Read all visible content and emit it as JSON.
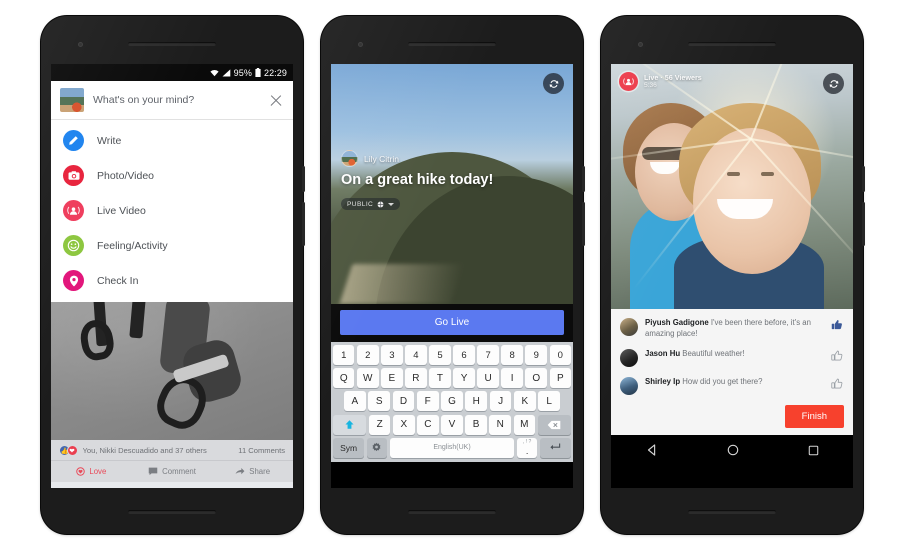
{
  "scene": {
    "title": "Facebook Live — three Android phone mockups",
    "background_color": "#ffffff"
  },
  "phone1": {
    "status_bar": {
      "wifi_icon": "wifi-icon",
      "signal_icon": "cell-signal-icon",
      "battery_percent": "95%",
      "battery_icon": "battery-icon",
      "clock": "22:29"
    },
    "composer": {
      "avatar": "user-avatar",
      "placeholder": "What's on your mind?",
      "close_icon": "close-icon"
    },
    "menu_items": [
      {
        "label": "Write",
        "icon": "pencil-icon",
        "color": "#1b82ef",
        "glyph": "✎"
      },
      {
        "label": "Photo/Video",
        "icon": "camera-icon",
        "color": "#e7203a",
        "glyph": "◉"
      },
      {
        "label": "Live Video",
        "icon": "live-video-icon",
        "color": "#ef3b5b",
        "glyph": "◉"
      },
      {
        "label": "Feeling/Activity",
        "icon": "smiley-icon",
        "color": "#8cc63e",
        "glyph": "☺"
      },
      {
        "label": "Check In",
        "icon": "location-pin-icon",
        "color": "#e2147a",
        "glyph": "◉"
      }
    ],
    "post": {
      "photo_alt": "gym-rings-photo",
      "reaction_like_icon": "like-icon",
      "reaction_love_icon": "love-icon",
      "reactions_text": "You, Nikki Descuadido and 37 others",
      "comments_count": "11 Comments",
      "actions": [
        {
          "label": "Love",
          "icon": "love-icon"
        },
        {
          "label": "Comment",
          "icon": "comment-icon"
        },
        {
          "label": "Share",
          "icon": "share-icon"
        }
      ]
    }
  },
  "phone2": {
    "flip_camera_icon": "flip-camera-icon",
    "user_name": "Lily Citrin",
    "caption": "On a great hike today!",
    "privacy": {
      "label": "PUBLIC",
      "icon": "globe-icon",
      "caret": "chevron-down-icon"
    },
    "go_live_label": "Go Live",
    "go_live_color": "#5b79f0",
    "keyboard": {
      "row_numbers": [
        "1",
        "2",
        "3",
        "4",
        "5",
        "6",
        "7",
        "8",
        "9",
        "0"
      ],
      "row_top": [
        "Q",
        "W",
        "E",
        "R",
        "T",
        "Y",
        "U",
        "I",
        "O",
        "P"
      ],
      "row_home": [
        "A",
        "S",
        "D",
        "F",
        "G",
        "H",
        "J",
        "K",
        "L"
      ],
      "row_bottom": [
        "Z",
        "X",
        "C",
        "V",
        "B",
        "N",
        "M"
      ],
      "shift_icon": "shift-arrow-icon",
      "backspace_icon": "backspace-icon",
      "sym_label": "Sym",
      "settings_icon": "gear-icon",
      "space_label": "English(UK)",
      "period_key": ".",
      "period_sub": ", ! ?",
      "enter_icon": "enter-icon"
    }
  },
  "phone3": {
    "live_badge_icon": "live-broadcast-icon",
    "live_status": "Live · 56 Viewers",
    "live_timer": "5:36",
    "flip_camera_icon": "flip-camera-icon",
    "video_alt": "two-women-selfie-live-video",
    "comments": [
      {
        "name": "Piyush Gadigone",
        "text": "I've been there before, it's an amazing place!",
        "liked": true,
        "thumb_icon": "thumbs-up-icon"
      },
      {
        "name": "Jason Hu",
        "text": "Beautiful weather!",
        "liked": false,
        "thumb_icon": "thumbs-up-outline-icon"
      },
      {
        "name": "Shirley Ip",
        "text": "How did you get there?",
        "liked": false,
        "thumb_icon": "thumbs-up-outline-icon"
      }
    ],
    "finish_label": "Finish",
    "finish_color": "#f7412d",
    "nav_bar": {
      "back_icon": "back-triangle-icon",
      "home_icon": "home-circle-icon",
      "recents_icon": "recents-square-icon"
    }
  }
}
